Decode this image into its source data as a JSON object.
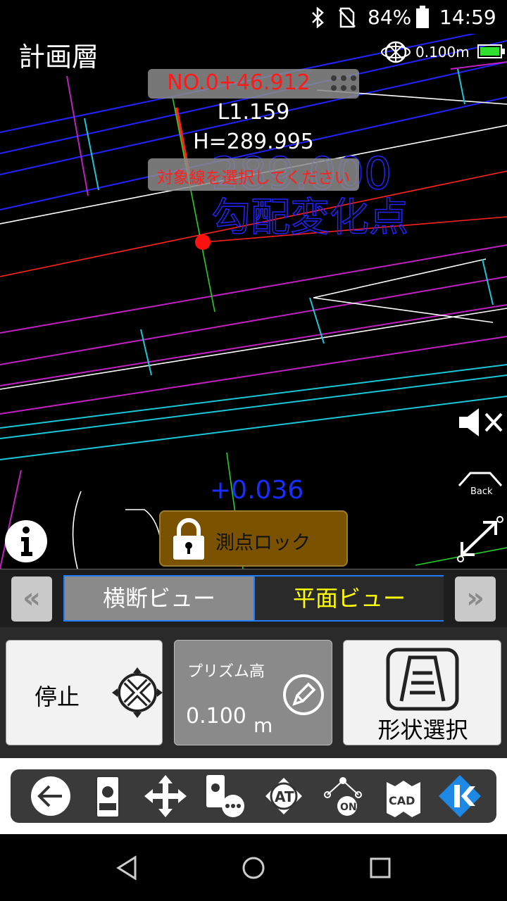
{
  "status_bar": {
    "battery_percent": "84%",
    "time": "14:59",
    "icons": [
      "bluetooth-icon",
      "no-sim-icon",
      "battery-icon"
    ]
  },
  "map": {
    "layer_title": "計画層",
    "gps_readout": "0.100m",
    "station": "NO.0+46.912",
    "offset": "L1.159",
    "height": "H=289.995",
    "message": "対象線を選択してください",
    "delta": "+0.036",
    "bg_label_number": "289.000",
    "bg_label_text": "勾配変化点",
    "lock_button_label": "測点ロック",
    "side_icons": [
      "mute-icon",
      "back-icon",
      "resize-icon"
    ],
    "info_icon": "info-icon",
    "colors": {
      "station": "#ff1a1a",
      "delta": "#1a2dff",
      "lock": "#7a5200"
    }
  },
  "tabs": {
    "prev": "«",
    "next": "»",
    "items": [
      "横断ビュー",
      "平面ビュー"
    ],
    "active_index": 1,
    "colors": {
      "active_text": "#ffff00",
      "inactive_bg": "#8a8a8a"
    }
  },
  "actions": {
    "stop_label": "停止",
    "prism_label": "プリズム高",
    "prism_value": "0.100",
    "prism_unit": "m",
    "shape_label": "形状選択"
  },
  "toolbar": {
    "icons": [
      "back-arrow-icon",
      "instrument-icon",
      "move-icon",
      "instrument-more-icon",
      "auto-track-icon",
      "point-on-icon",
      "cad-icon",
      "k-logo-icon"
    ]
  },
  "navbar": {
    "icons": [
      "nav-back-icon",
      "nav-home-icon",
      "nav-recent-icon"
    ]
  }
}
